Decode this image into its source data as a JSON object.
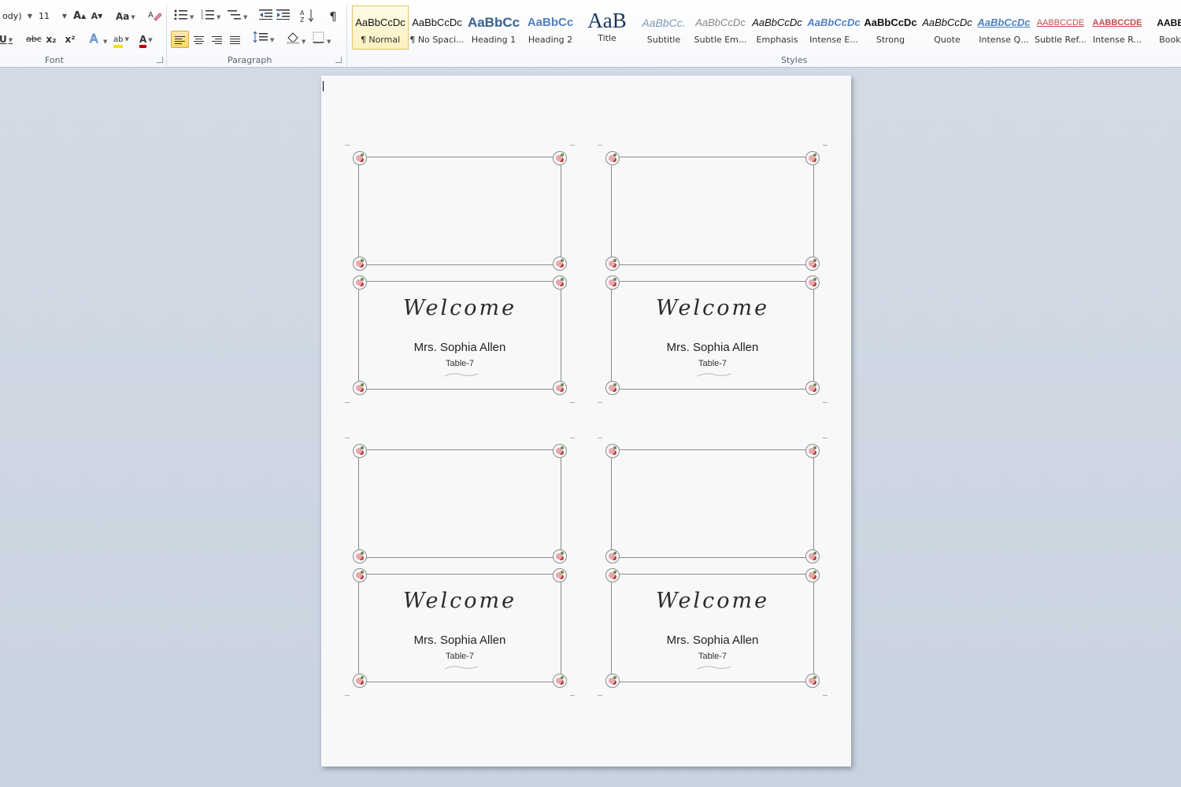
{
  "font_group": {
    "font_name": "ody)",
    "font_size": "11",
    "label": "Font",
    "grow_font": "A",
    "shrink_font": "A",
    "change_case": "Aa",
    "bold_underline": "U",
    "strikethrough": "abc",
    "subscript": "x₂",
    "superscript": "x²",
    "highlight": "ab",
    "font_color": "A"
  },
  "paragraph_group": {
    "label": "Paragraph",
    "sort": "A↓Z",
    "pilcrow": "¶"
  },
  "styles_group": {
    "label": "Styles",
    "tiles": [
      {
        "preview": "AaBbCcDc",
        "name": "¶ Normal"
      },
      {
        "preview": "AaBbCcDc",
        "name": "¶ No Spaci..."
      },
      {
        "preview": "AaBbCc",
        "name": "Heading 1"
      },
      {
        "preview": "AaBbCc",
        "name": "Heading 2"
      },
      {
        "preview": "AaB",
        "name": "Title"
      },
      {
        "preview": "AaBbCc.",
        "name": "Subtitle"
      },
      {
        "preview": "AaBbCcDc",
        "name": "Subtle Em..."
      },
      {
        "preview": "AaBbCcDc",
        "name": "Emphasis"
      },
      {
        "preview": "AaBbCcDc",
        "name": "Intense E..."
      },
      {
        "preview": "AaBbCcDc",
        "name": "Strong"
      },
      {
        "preview": "AaBbCcDc",
        "name": "Quote"
      },
      {
        "preview": "AaBbCcDc",
        "name": "Intense Q..."
      },
      {
        "preview": "AABBCCDE",
        "name": "Subtle Ref..."
      },
      {
        "preview": "AABBCCDE",
        "name": "Intense R..."
      },
      {
        "preview": "AABBC",
        "name": "Book T"
      }
    ]
  },
  "colors": {
    "selected_style_border": "#e3c56b",
    "highlight_yellow": "#f4e300",
    "font_color_red": "#c00000",
    "heading_blue": "#366092",
    "card_border": "#8b8b8b",
    "flower_pink": "#e9a7b0",
    "flower_red": "#b23a3a"
  },
  "cards": [
    {
      "welcome": "Welcome",
      "guest": "Mrs. Sophia Allen",
      "table": "Table-7"
    },
    {
      "welcome": "Welcome",
      "guest": "Mrs. Sophia Allen",
      "table": "Table-7"
    },
    {
      "welcome": "Welcome",
      "guest": "Mrs. Sophia Allen",
      "table": "Table-7"
    },
    {
      "welcome": "Welcome",
      "guest": "Mrs. Sophia Allen",
      "table": "Table-7"
    }
  ]
}
